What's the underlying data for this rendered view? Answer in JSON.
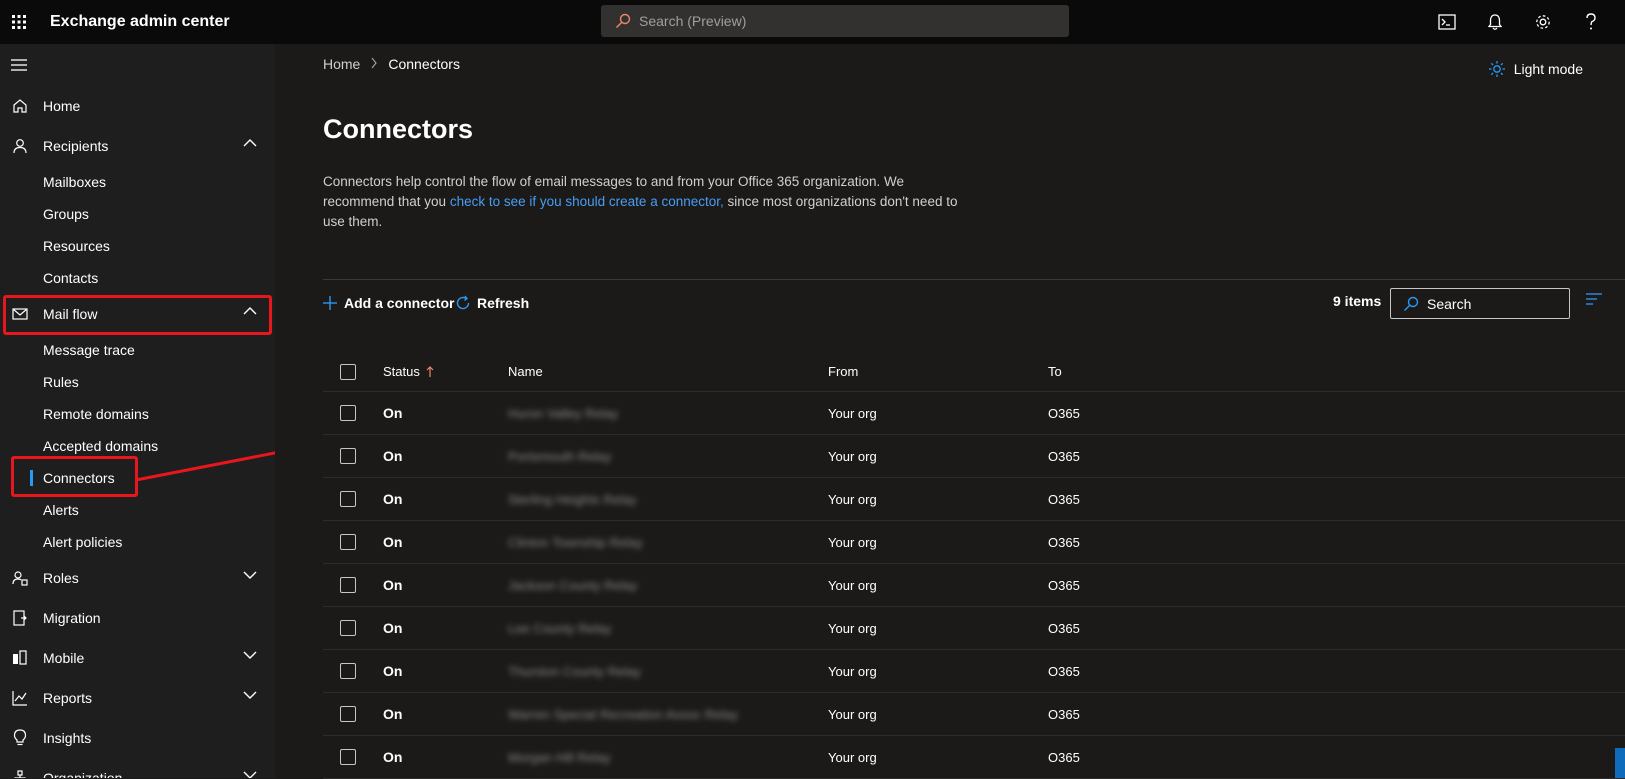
{
  "topbar": {
    "app_title": "Exchange admin center",
    "search_placeholder": "Search (Preview)"
  },
  "sidebar": {
    "items": [
      {
        "label": "Home",
        "icon": "home-icon"
      },
      {
        "label": "Recipients",
        "icon": "person-icon",
        "expanded": true
      },
      {
        "label": "Mailboxes"
      },
      {
        "label": "Groups"
      },
      {
        "label": "Resources"
      },
      {
        "label": "Contacts"
      },
      {
        "label": "Mail flow",
        "icon": "mail-icon",
        "expanded": true
      },
      {
        "label": "Message trace"
      },
      {
        "label": "Rules"
      },
      {
        "label": "Remote domains"
      },
      {
        "label": "Accepted domains"
      },
      {
        "label": "Connectors",
        "selected": true
      },
      {
        "label": "Alerts"
      },
      {
        "label": "Alert policies"
      },
      {
        "label": "Roles",
        "icon": "roles-icon"
      },
      {
        "label": "Migration",
        "icon": "migration-icon"
      },
      {
        "label": "Mobile",
        "icon": "mobile-icon"
      },
      {
        "label": "Reports",
        "icon": "reports-icon"
      },
      {
        "label": "Insights",
        "icon": "lightbulb-icon"
      },
      {
        "label": "Organization",
        "icon": "organization-icon"
      }
    ]
  },
  "breadcrumb": {
    "home": "Home",
    "current": "Connectors"
  },
  "light_mode_label": "Light mode",
  "page": {
    "title": "Connectors",
    "desc_pre": "Connectors help control the flow of email messages to and from your Office 365 organization. We recommend that you ",
    "desc_link": "check to see if you should create a connector,",
    "desc_post": " since most organizations don't need to use them."
  },
  "toolbar": {
    "add_label": "Add a connector",
    "refresh_label": "Refresh",
    "count": "9 items",
    "search_placeholder": "Search"
  },
  "table": {
    "headers": {
      "status": "Status",
      "name": "Name",
      "from": "From",
      "to": "To"
    },
    "rows": [
      {
        "status": "On",
        "name": "Huron Valley Relay",
        "from": "Your org",
        "to": "O365"
      },
      {
        "status": "On",
        "name": "Portsmouth Relay",
        "from": "Your org",
        "to": "O365"
      },
      {
        "status": "On",
        "name": "Sterling Heights Relay",
        "from": "Your org",
        "to": "O365"
      },
      {
        "status": "On",
        "name": "Clinton Township Relay",
        "from": "Your org",
        "to": "O365"
      },
      {
        "status": "On",
        "name": "Jackson County Relay",
        "from": "Your org",
        "to": "O365"
      },
      {
        "status": "On",
        "name": "Lee County Relay",
        "from": "Your org",
        "to": "O365"
      },
      {
        "status": "On",
        "name": "Thurston County Relay",
        "from": "Your org",
        "to": "O365"
      },
      {
        "status": "On",
        "name": "Warren Special Recreation Assoc Relay",
        "from": "Your org",
        "to": "O365"
      },
      {
        "status": "On",
        "name": "Morgan Hill Relay",
        "from": "Your org",
        "to": "O365"
      }
    ]
  },
  "colors": {
    "accent": "#2899f5",
    "highlight": "#e8161d",
    "link": "#479ef5"
  }
}
